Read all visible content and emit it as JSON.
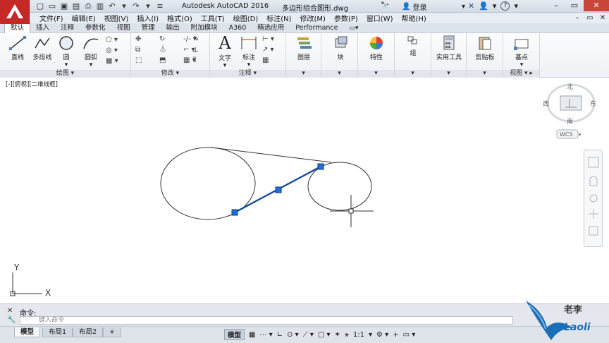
{
  "title_bar": {
    "app_title": "Autodesk AutoCAD 2016",
    "file_title": "多边形组合图形.dwg",
    "search_icon_label": "",
    "login_label": "登录",
    "help_label": "?"
  },
  "menu": {
    "items": [
      "文件(F)",
      "编辑(E)",
      "视图(V)",
      "插入(I)",
      "格式(O)",
      "工具(T)",
      "绘图(D)",
      "标注(N)",
      "修改(M)",
      "参数(P)",
      "窗口(W)",
      "帮助(H)"
    ]
  },
  "ribbon_tabs": [
    "默认",
    "插入",
    "注释",
    "参数化",
    "视图",
    "管理",
    "输出",
    "附加模块",
    "A360",
    "精选应用",
    "Performance"
  ],
  "ribbon": {
    "draw_panel": {
      "label": "绘图",
      "buttons": [
        "直线",
        "多段线",
        "圆",
        "圆弧"
      ]
    },
    "modify_panel": {
      "label": "修改"
    },
    "annotation_panel": {
      "label": "注释",
      "buttons": [
        "文字",
        "标注"
      ]
    },
    "layers_btn": "图层",
    "block_btn": "块",
    "properties_btn": "特性",
    "group_btn": "组",
    "utilities_btn": "实用工具",
    "clipboard_btn": "剪贴板",
    "view_panel": {
      "label": "视图",
      "button": "基点"
    }
  },
  "viewport": {
    "label": "[-][俯视][二维线框]",
    "viewcube": {
      "north": "北",
      "south": "南",
      "east": "东",
      "west": "西",
      "wcs": "WCS"
    },
    "ucs": {
      "x": "X",
      "y": "Y"
    }
  },
  "command": {
    "history": "命令:",
    "placeholder": "键入命令"
  },
  "layout_tabs": [
    "模型",
    "布局1",
    "布局2",
    "+"
  ],
  "status": {
    "model_label": "模型",
    "scale": "1:1"
  },
  "watermark": {
    "text": "老李",
    "brand": "Laoli"
  },
  "colors": {
    "logo_red": "#c62828",
    "selection_blue": "#1e6fd9"
  }
}
